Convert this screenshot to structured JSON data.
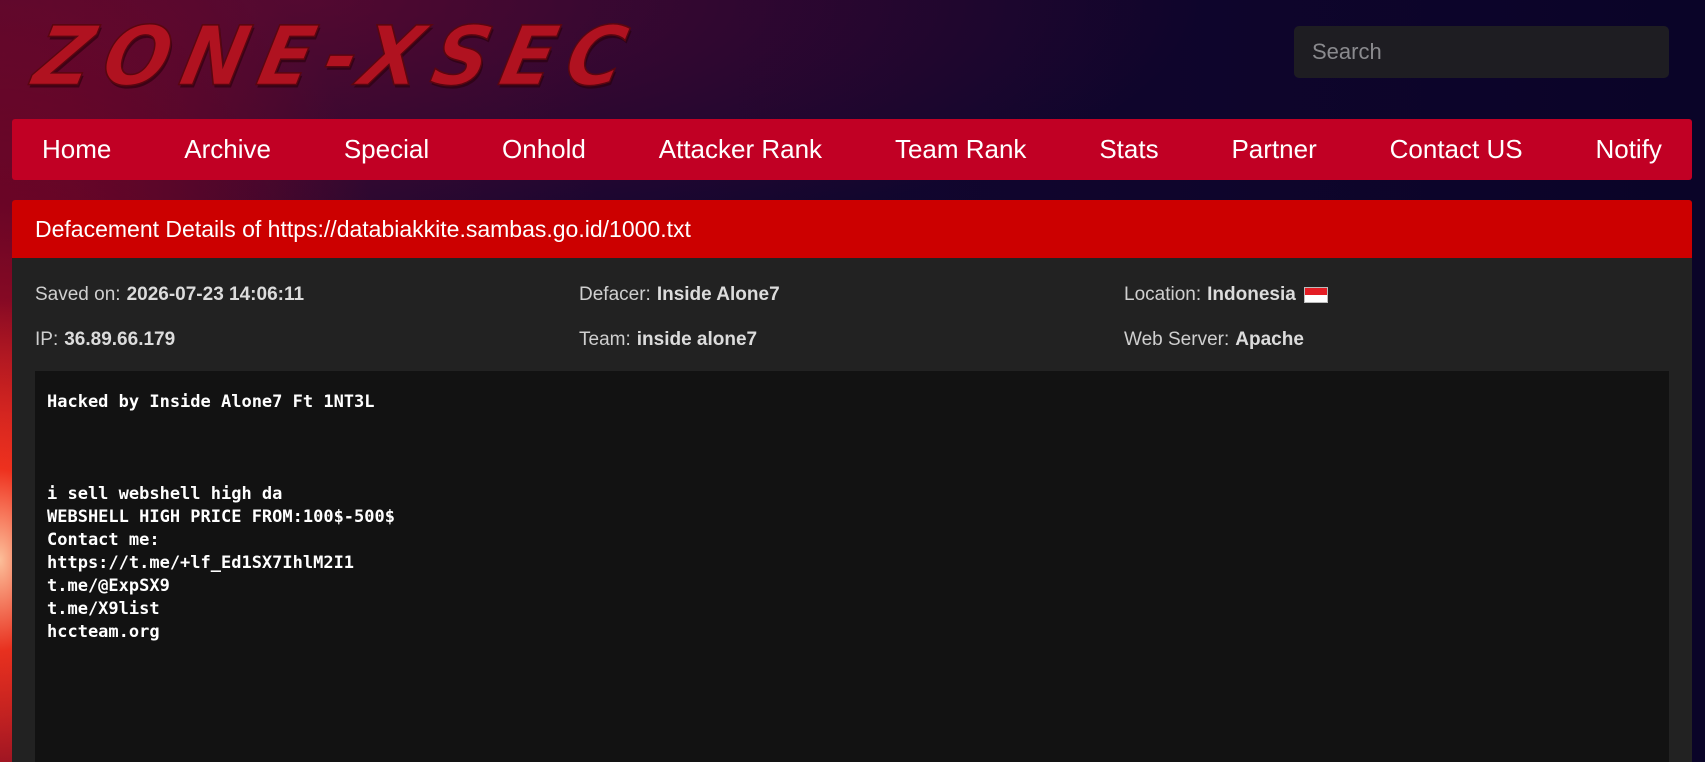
{
  "header": {
    "logo_text": "ZONE-XSEC",
    "search": {
      "placeholder": "Search",
      "value": ""
    }
  },
  "nav": {
    "items": [
      {
        "label": "Home"
      },
      {
        "label": "Archive"
      },
      {
        "label": "Special"
      },
      {
        "label": "Onhold"
      },
      {
        "label": "Attacker Rank"
      },
      {
        "label": "Team Rank"
      },
      {
        "label": "Stats"
      },
      {
        "label": "Partner"
      },
      {
        "label": "Contact US"
      },
      {
        "label": "Notify"
      }
    ]
  },
  "details": {
    "title": "Defacement Details of https://databiakkite.sambas.go.id/1000.txt",
    "saved_on_label": "Saved on:",
    "saved_on": "2026-07-23 14:06:11",
    "defacer_label": "Defacer:",
    "defacer": "Inside Alone7",
    "location_label": "Location:",
    "location": "Indonesia",
    "ip_label": "IP:",
    "ip": "36.89.66.179",
    "team_label": "Team:",
    "team": "inside alone7",
    "web_server_label": "Web Server:",
    "web_server": "Apache",
    "content": "Hacked by Inside Alone7 Ft 1NT3L\n\n\n\ni sell webshell high da\nWEBSHELL HIGH PRICE FROM:100$-500$\nContact me:\nhttps://t.me/+lf_Ed1SX7IhlM2I1\nt.me/@ExpSX9\nt.me/X9list\nhccteam.org"
  },
  "colors": {
    "nav_bg": "#c10024",
    "panel_header_bg": "#cc0000",
    "panel_bg": "#222222",
    "content_bg": "#121212",
    "logo": "#b01220"
  },
  "icons": {
    "location_flag": "indonesia-flag-icon"
  }
}
